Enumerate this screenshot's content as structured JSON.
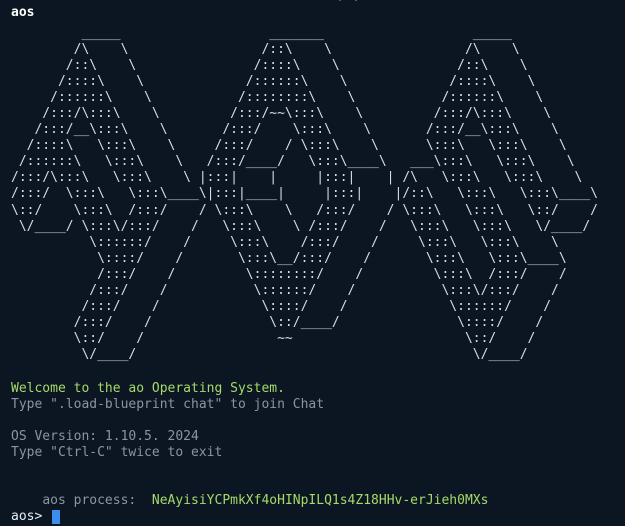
{
  "terminal": {
    "top_clip": "`                     ) ,",
    "title": "aos",
    "ascii_art": "         _____                   _______                   _____\n        /\\    \\                 /::\\    \\                 /\\    \\\n       /::\\    \\               /::::\\    \\               /::\\    \\\n      /::::\\    \\             /::::::\\    \\             /::::\\    \\\n     /::::::\\    \\           /::::::::\\    \\           /::::::\\    \\\n    /:::/\\:::\\    \\         /:::/~~\\:::\\    \\         /:::/\\:::\\    \\\n   /:::/__\\:::\\    \\       /:::/    \\:::\\    \\       /:::/__\\:::\\    \\\n  /::::\\   \\:::\\    \\     /:::/    / \\:::\\    \\      \\:::\\   \\:::\\    \\\n /::::::\\   \\:::\\    \\   /:::/____/   \\:::\\____\\   ___\\:::\\   \\:::\\    \\\n/:::/\\:::\\   \\:::\\    \\ |:::|    |     |:::|    | /\\   \\:::\\   \\:::\\    \\\n/:::/  \\:::\\   \\:::\\____\\|:::|____|     |:::|    |/::\\   \\:::\\   \\:::\\____\\\n\\::/    \\:::\\  /:::/    / \\:::\\    \\   /:::/    / \\:::\\   \\:::\\   \\::/    /\n \\/____/ \\:::\\/:::/    /   \\:::\\    \\ /:::/    /   \\:::\\   \\:::\\   \\/____/\n          \\::::::/    /     \\:::\\    /:::/    /     \\:::\\   \\:::\\    \\\n           \\::::/    /       \\:::\\__/:::/    /       \\:::\\   \\:::\\____\\\n           /:::/    /         \\::::::::/    /         \\:::\\  /:::/    /\n          /:::/    /           \\::::::/    /           \\:::\\/:::/    /\n         /:::/    /             \\::::/    /             \\::::::/    /\n        /:::/    /               \\::/____/               \\::::/    /\n        \\::/    /                 ~~                      \\::/    /\n         \\/____/                                           \\/____/",
    "welcome": "Welcome to the ao Operating System.",
    "join_hint": "Type \".load-blueprint chat\" to join Chat",
    "os_version": "OS Version: 1.10.5. 2024",
    "exit_hint": "Type \"Ctrl-C\" twice to exit",
    "process_label": "aos process:",
    "process_id": "NeAyisiYCPmkXf4oHINpILQ1s4Z18HHv-erJieh0MXs",
    "prompt": "aos>"
  },
  "colors": {
    "background": "#0b1622",
    "green": "#a6d96a",
    "dim": "#8b95a1",
    "cursor": "#3b8eea"
  }
}
